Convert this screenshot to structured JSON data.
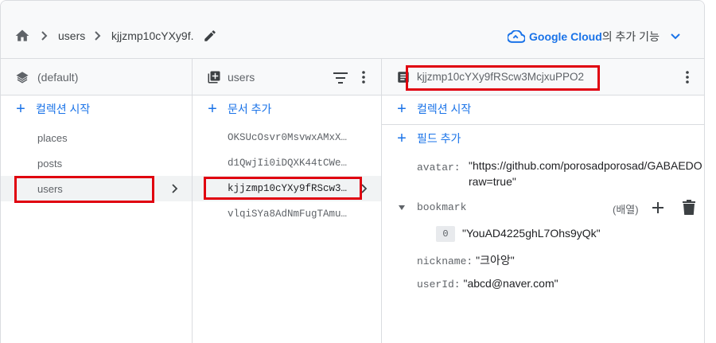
{
  "breadcrumb": {
    "home_icon": "home-icon",
    "items": [
      "users",
      "kjjzmp10cYXy9f."
    ],
    "edit_icon": "pencil-icon"
  },
  "google_cloud": {
    "name": "Google Cloud",
    "suffix": "의 추가 기능",
    "icon": "cloud-icon",
    "chevron": "chevron-down-icon"
  },
  "root_panel": {
    "title": "(default)",
    "icon": "database-stack-icon",
    "add_label": "컬렉션 시작",
    "collections": [
      "places",
      "posts",
      "users"
    ],
    "selected_index": 2
  },
  "collection_panel": {
    "title": "users",
    "icon": "collection-icon",
    "add_label": "문서 추가",
    "documents": [
      "OKSUcOsvr0MsvwxAMxX…",
      "d1QwjIi0iDQXK44tCWe…",
      "kjjzmp10cYXy9fRScw3…",
      "vlqiSYa8AdNmFugTAmu…"
    ],
    "selected_index": 2
  },
  "document_panel": {
    "title": "kjjzmp10cYXy9fRScw3McjxuPPO2",
    "icon": "document-icon",
    "add_collection_label": "컬렉션 시작",
    "add_field_label": "필드 추가",
    "fields": {
      "avatar": {
        "key": "avatar:",
        "value_line1": "\"https://github.com/porosadporosad/GABAEDO",
        "value_line2": "raw=true\""
      },
      "bookmark": {
        "key": "bookmark",
        "type_label": "(배열)",
        "item_index": "0",
        "item_value": "\"YouAD4225ghL7Ohs9yQk\""
      },
      "nickname": {
        "key": "nickname:",
        "value": "\"크아앙\""
      },
      "userId": {
        "key": "userId:",
        "value": "\"abcd@naver.com\""
      }
    }
  },
  "colors": {
    "accent": "#1a73e8",
    "highlight_box": "#e0000f",
    "header_bg": "#f8f9fa",
    "selected_bg": "#f1f3f4"
  }
}
